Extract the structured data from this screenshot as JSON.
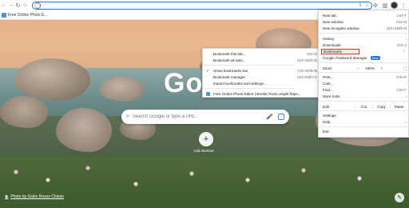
{
  "toolbar": {
    "back_icon": "←",
    "forward_icon": "→",
    "reload_icon": "↻",
    "home_icon": "⌂",
    "address_value": "",
    "share_icon": "⇪",
    "star_icon": "☆",
    "extensions_icon": "✣",
    "sidepanel_icon": "▥",
    "menu_icon": "⋮"
  },
  "bookmarks_bar": {
    "items": [
      {
        "label": "Free Online Photo E..."
      }
    ]
  },
  "ntp": {
    "logo_text": "Go",
    "search_placeholder": "Search Google or type a URL",
    "search_icon": "⌕",
    "mic_icon": "🎤",
    "add_shortcut_plus": "+",
    "add_shortcut_label": "Add shortcut",
    "credit_text": "Photo by Giulio Rosso Chioso",
    "credit_icon": "◉",
    "edit_icon": "✎"
  },
  "menu": {
    "new_tab": {
      "label": "New tab",
      "shortcut": "Ctrl+T"
    },
    "new_window": {
      "label": "New window",
      "shortcut": "Ctrl+N"
    },
    "new_incognito": {
      "label": "New Incognito window",
      "shortcut": "Ctrl+Shift+N"
    },
    "history": {
      "label": "History"
    },
    "downloads": {
      "label": "Downloads",
      "shortcut": "Ctrl+J"
    },
    "bookmarks": {
      "label": "Bookmarks"
    },
    "password_manager": {
      "label": "Google Password Manager",
      "badge": "New"
    },
    "zoom": {
      "label": "Zoom",
      "minus": "−",
      "value": "100%",
      "plus": "+",
      "fullscreen": "⛶"
    },
    "print": {
      "label": "Print...",
      "shortcut": "Ctrl+P"
    },
    "cast": {
      "label": "Cast..."
    },
    "find": {
      "label": "Find...",
      "shortcut": "Ctrl+F"
    },
    "more_tools": {
      "label": "More tools"
    },
    "edit": {
      "label": "Edit",
      "cut": "Cut",
      "copy": "Copy",
      "paste": "Paste"
    },
    "settings": {
      "label": "Settings"
    },
    "help": {
      "label": "Help"
    },
    "exit": {
      "label": "Exit"
    }
  },
  "bookmarks_submenu": {
    "bookmark_tab": {
      "label": "Bookmark this tab...",
      "shortcut": "Ctrl+D"
    },
    "bookmark_all": {
      "label": "Bookmark all tabs...",
      "shortcut": "Ctrl+Shift+D"
    },
    "show_bar": {
      "label": "Show bookmarks bar",
      "shortcut": "Ctrl+Shift+B",
      "check": "✓"
    },
    "manager": {
      "label": "Bookmark manager",
      "shortcut": "Ctrl+Shift+O"
    },
    "import": {
      "label": "Import bookmarks and settings..."
    },
    "bookmark_item": {
      "label": "Free Online Photo Editor | Border,Tools,unsplit https..."
    }
  },
  "colors": {
    "accent": "#1a73e8",
    "highlight_border": "#d93025"
  }
}
